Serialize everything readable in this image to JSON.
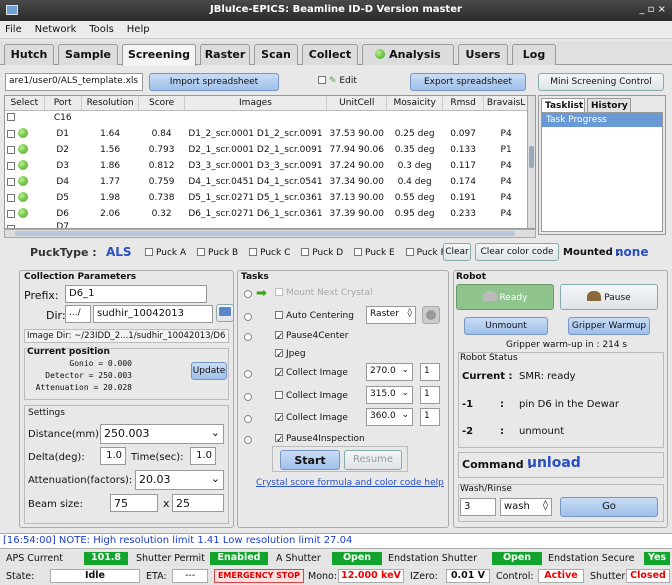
{
  "window": {
    "title": "JBluIce-EPICS: Beamline ID-D Version master",
    "controls": "_ ▫ ×"
  },
  "menu": [
    "File",
    "Network",
    "Tools",
    "Help"
  ],
  "tabs": [
    "Hutch",
    "Sample",
    "Screening",
    "Raster",
    "Scan",
    "Collect",
    "Analysis",
    "Users",
    "Log"
  ],
  "toolbar": {
    "spreadsheet_path": "are1/user0/ALS_template.xls",
    "import_label": "Import spreadsheet",
    "edit_label": "Edit",
    "export_label": "Export spreadsheet",
    "mini_label": "Mini Screening Control"
  },
  "table": {
    "columns": [
      "Select",
      "Port",
      "Resolution",
      "Score",
      "Images",
      "UnitCell",
      "Mosaicity",
      "Rmsd",
      "BravaisL"
    ],
    "partial_top_port": "C16",
    "rows": [
      {
        "port": "D1",
        "resolution": "1.64",
        "score": "0.84",
        "images": "D1_2_scr.0001 D1_2_scr.0091",
        "unitcell": "37.53 90.00",
        "mosaicity": "0.25 deg",
        "rmsd": "0.097",
        "bravais": "P4"
      },
      {
        "port": "D2",
        "resolution": "1.56",
        "score": "0.793",
        "images": "D2_1_scr.0001 D2_1_scr.0091",
        "unitcell": "77.94 90.06",
        "mosaicity": "0.35 deg",
        "rmsd": "0.133",
        "bravais": "P1"
      },
      {
        "port": "D3",
        "resolution": "1.86",
        "score": "0.812",
        "images": "D3_3_scr.0001 D3_3_scr.0091",
        "unitcell": "37.24 90.00",
        "mosaicity": "0.3 deg",
        "rmsd": "0.117",
        "bravais": "P4"
      },
      {
        "port": "D4",
        "resolution": "1.77",
        "score": "0.759",
        "images": "D4_1_scr.0451 D4_1_scr.0541",
        "unitcell": "37.34 90.00",
        "mosaicity": "0.4 deg",
        "rmsd": "0.174",
        "bravais": "P4"
      },
      {
        "port": "D5",
        "resolution": "1.98",
        "score": "0.738",
        "images": "D5_1_scr.0271 D5_1_scr.0361",
        "unitcell": "37.13 90.00",
        "mosaicity": "0.55 deg",
        "rmsd": "0.191",
        "bravais": "P4"
      },
      {
        "port": "D6",
        "resolution": "2.06",
        "score": "0.32",
        "images": "D6_1_scr.0271 D6_1_scr.0361",
        "unitcell": "37.39 90.00",
        "mosaicity": "0.95 deg",
        "rmsd": "0.233",
        "bravais": "P4"
      }
    ],
    "partial_bottom_port": "D7"
  },
  "right_tabs": [
    "Tasklist",
    "History"
  ],
  "task_progress": "Task Progress",
  "puck_bar": {
    "label": "PuckType :",
    "type": "ALS",
    "pucks": [
      "Puck A",
      "Puck B",
      "Puck C",
      "Puck D",
      "Puck E",
      "Puck F"
    ],
    "clear": "Clear",
    "clear_color": "Clear color code",
    "mounted_label": "Mounted :",
    "mounted_value": "none"
  },
  "collection": {
    "title": "Collection Parameters",
    "prefix_label": "Prefix:",
    "prefix": "D6_1",
    "dir_label": "Dir:",
    "dir_prefix": ".../",
    "dir": "sudhir_10042013",
    "image_dir": "Image Dir: ~/23IDD_2...1/sudhir_10042013/D6",
    "current_position": "Current position",
    "gonio": "Gonio = 0.000",
    "detector": "Detector = 250.003",
    "attenuation": "Attenuation = 20.028",
    "update": "Update",
    "settings": "Settings",
    "distance_label": "Distance(mm):",
    "distance": "250.003",
    "delta_label": "Delta(deg):",
    "delta": "1.0",
    "time_label": "Time(sec):",
    "time": "1.0",
    "atten_label": "Attenuation(factors):",
    "atten": "20.03",
    "beam_label": "Beam size:",
    "beam_x": "75",
    "beam_sep": "x",
    "beam_y": "25"
  },
  "tasks": {
    "title": "Tasks",
    "mount_next": "Mount Next Crystal",
    "auto_centering": "Auto Centering",
    "raster": "Raster",
    "pause4center": "Pause4Center",
    "jpeg": "Jpeg",
    "collect1": "Collect Image",
    "collect1_val": "270.0",
    "collect1_n": "1",
    "collect2": "Collect Image",
    "collect2_val": "315.0",
    "collect2_n": "1",
    "collect3": "Collect Image",
    "collect3_val": "360.0",
    "collect3_n": "1",
    "pause4inspection": "Pause4Inspection",
    "start": "Start",
    "resume": "Resume",
    "link": "Crystal score formula and color code help"
  },
  "robot": {
    "title": "Robot",
    "ready": "Ready",
    "pause": "Pause",
    "unmount": "Unmount",
    "gripper": "Gripper Warmup",
    "warmup": "Gripper warm-up in : 214 s",
    "status_title": "Robot Status",
    "current_label": "Current :",
    "current_value": "SMR: ready",
    "r1_label": "-1",
    "r1_sep": ":",
    "r1_value": "pin D6 in the Dewar",
    "r2_label": "-2",
    "r2_sep": ":",
    "r2_value": "unmount",
    "command_label": "Command :",
    "command_value": "unload",
    "wash_title": "Wash/Rinse",
    "wash_n": "3",
    "wash_sel": "wash",
    "go": "Go"
  },
  "log_line": "[16:54:00] NOTE: High resolution limit 1.41 Low resolution limit 27.04",
  "status": {
    "aps_label": "APS Current",
    "aps_value": "101.8",
    "shutter_permit_label": "Shutter Permit",
    "shutter_permit_value": "Enabled",
    "a_shutter_label": "A Shutter",
    "a_shutter_value": "Open",
    "end_shutter_label": "Endstation Shutter",
    "end_shutter_value": "Open",
    "end_secure_label": "Endstation Secure",
    "end_secure_value": "Yes",
    "state_label": "State:",
    "state_value": "Idle",
    "eta_label": "ETA:",
    "eta_value": "---",
    "estop": "EMERGENCY STOP",
    "mono_label": "Mono:",
    "mono_value": "12.000 keV",
    "izero_label": "IZero:",
    "izero_value": "0.01 V",
    "control_label": "Control:",
    "control_value": "Active",
    "shutter_label": "Shutter:",
    "shutter_value": "Closed"
  }
}
